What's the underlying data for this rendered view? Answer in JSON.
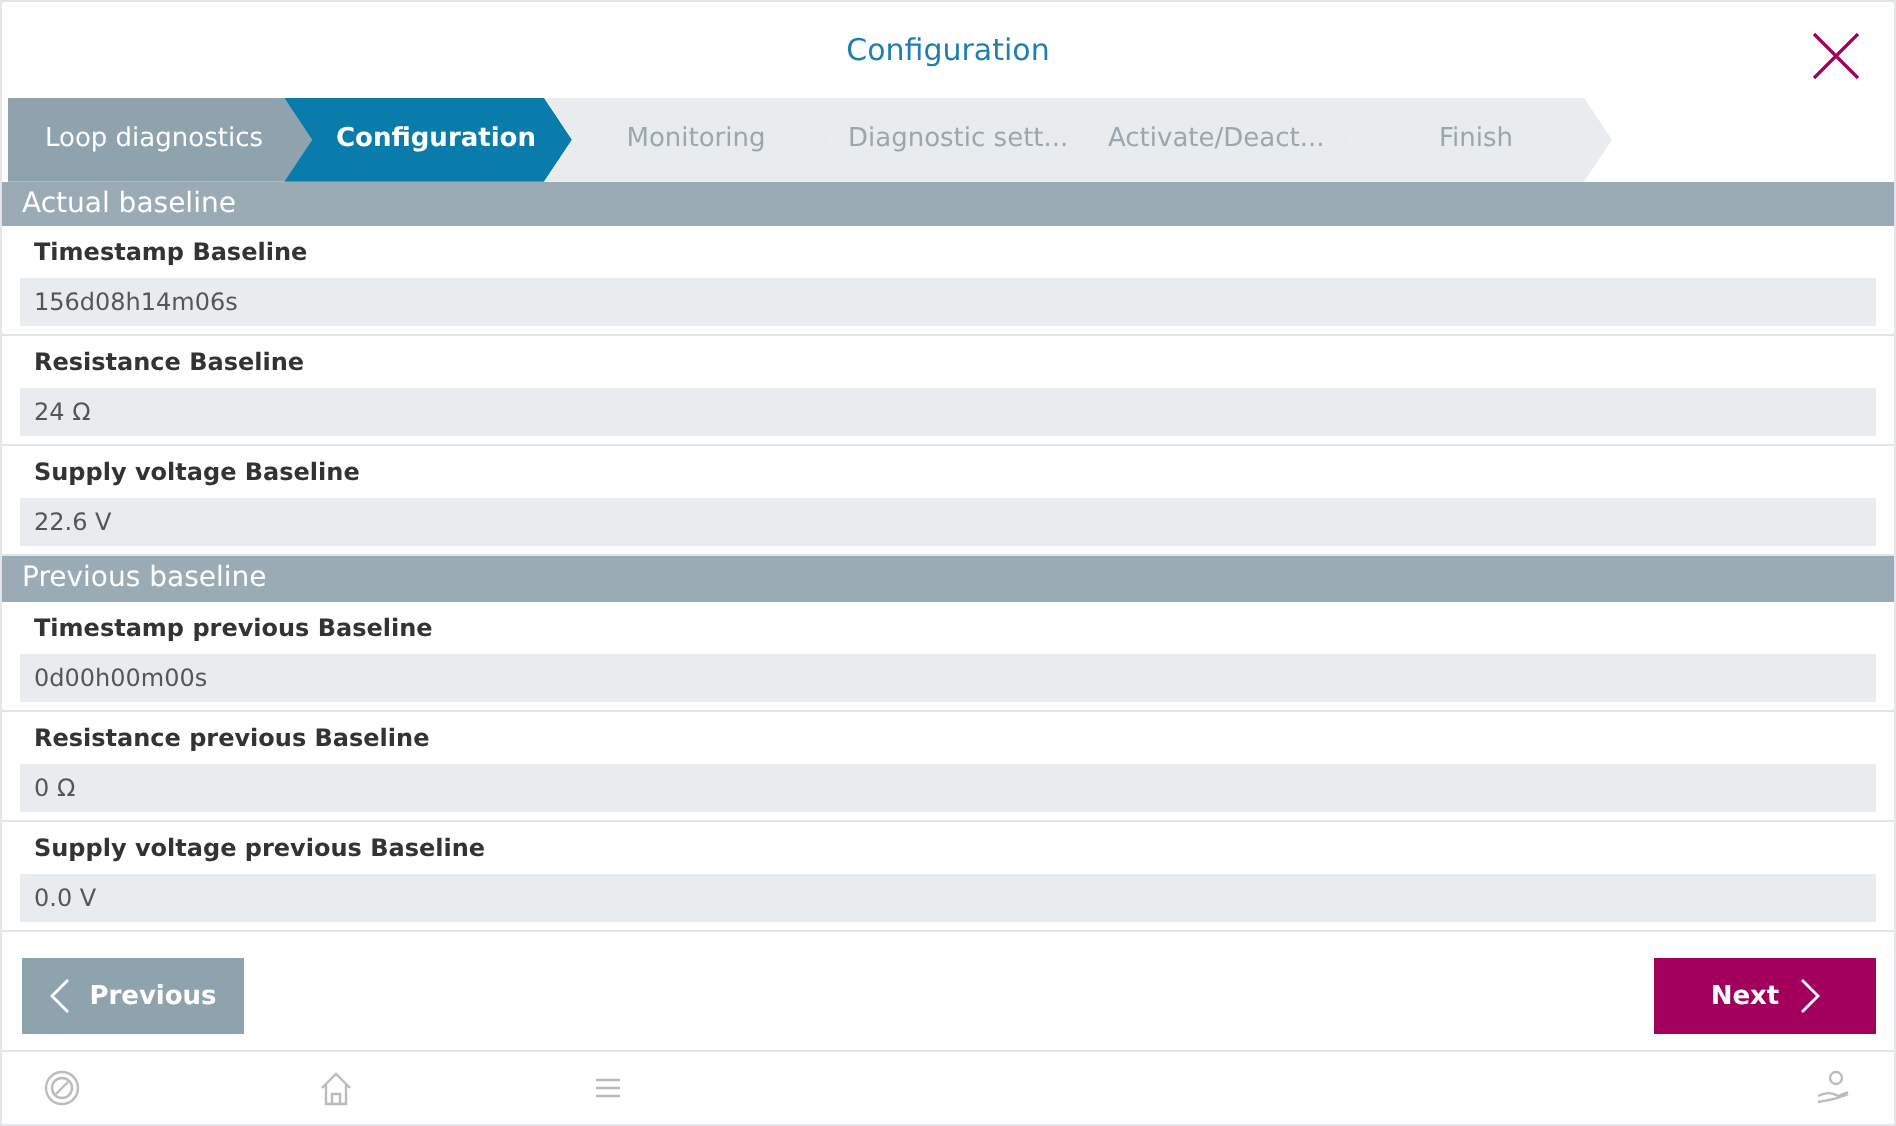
{
  "header": {
    "title": "Configuration"
  },
  "steps": [
    {
      "label": "Loop diagnostics",
      "completed": true,
      "selected": false
    },
    {
      "label": "Configuration",
      "completed": false,
      "selected": true
    },
    {
      "label": "Monitoring",
      "completed": false,
      "selected": false
    },
    {
      "label": "Diagnostic sett...",
      "completed": false,
      "selected": false
    },
    {
      "label": "Activate/Deact...",
      "completed": false,
      "selected": false
    },
    {
      "label": "Finish",
      "completed": false,
      "selected": false
    }
  ],
  "sections": [
    {
      "title": "Actual baseline",
      "fields": [
        {
          "label": "Timestamp Baseline",
          "value": "156d08h14m06s"
        },
        {
          "label": "Resistance Baseline",
          "value": "24 Ω"
        },
        {
          "label": "Supply voltage Baseline",
          "value": "22.6 V"
        }
      ]
    },
    {
      "title": "Previous baseline",
      "fields": [
        {
          "label": "Timestamp previous Baseline",
          "value": "0d00h00m00s"
        },
        {
          "label": "Resistance previous Baseline",
          "value": "0 Ω"
        },
        {
          "label": "Supply voltage previous Baseline",
          "value": "0.0 V"
        }
      ]
    }
  ],
  "buttons": {
    "previous": "Previous",
    "next": "Next"
  }
}
